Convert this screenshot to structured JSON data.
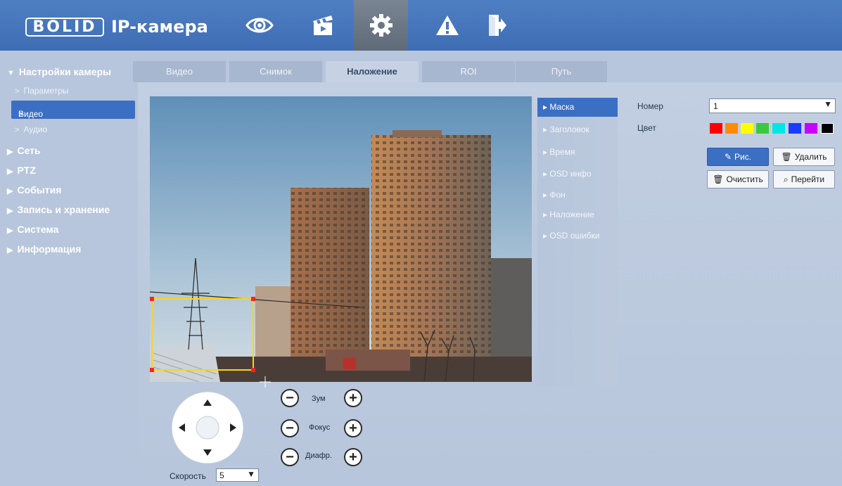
{
  "header": {
    "logo": "BOLID",
    "title": "IP-камера",
    "nav": [
      {
        "name": "live-view",
        "icon": "eye-icon"
      },
      {
        "name": "playback",
        "icon": "clapperboard-icon"
      },
      {
        "name": "settings",
        "icon": "gear-icon",
        "active": true
      },
      {
        "name": "alarm",
        "icon": "warning-icon"
      },
      {
        "name": "logout",
        "icon": "exit-icon"
      }
    ]
  },
  "sidebar": {
    "groups": [
      {
        "label": "Настройки камеры",
        "expanded": true,
        "items": [
          "Параметры",
          "Видео",
          "Аудио"
        ],
        "active_item": "Видео"
      },
      {
        "label": "Сеть"
      },
      {
        "label": "PTZ"
      },
      {
        "label": "События"
      },
      {
        "label": "Запись и хранение"
      },
      {
        "label": "Система"
      },
      {
        "label": "Информация"
      }
    ]
  },
  "tabs": [
    "Видео",
    "Снимок",
    "Наложение",
    "ROI",
    "Путь"
  ],
  "active_tab": "Наложение",
  "submenu": [
    "Маска",
    "Заголовок",
    "Время",
    "OSD инфо",
    "Фон",
    "Наложение",
    "OSD ошибки"
  ],
  "active_submenu": "Маска",
  "mask": {
    "number_label": "Номер",
    "number_value": "1",
    "color_label": "Цвет",
    "colors": [
      "#ff0000",
      "#ff8c00",
      "#ffff00",
      "#3cc83c",
      "#00e6e6",
      "#1a3cff",
      "#c800ff",
      "#000000"
    ],
    "buttons": {
      "draw": "Рис.",
      "delete": "Удалить",
      "clear": "Очистить",
      "goto": "Перейти"
    }
  },
  "ptz": {
    "zoom_label": "Зум",
    "focus_label": "Фокус",
    "iris_label": "Диафр.",
    "speed_label": "Скорость",
    "speed_value": "5"
  }
}
